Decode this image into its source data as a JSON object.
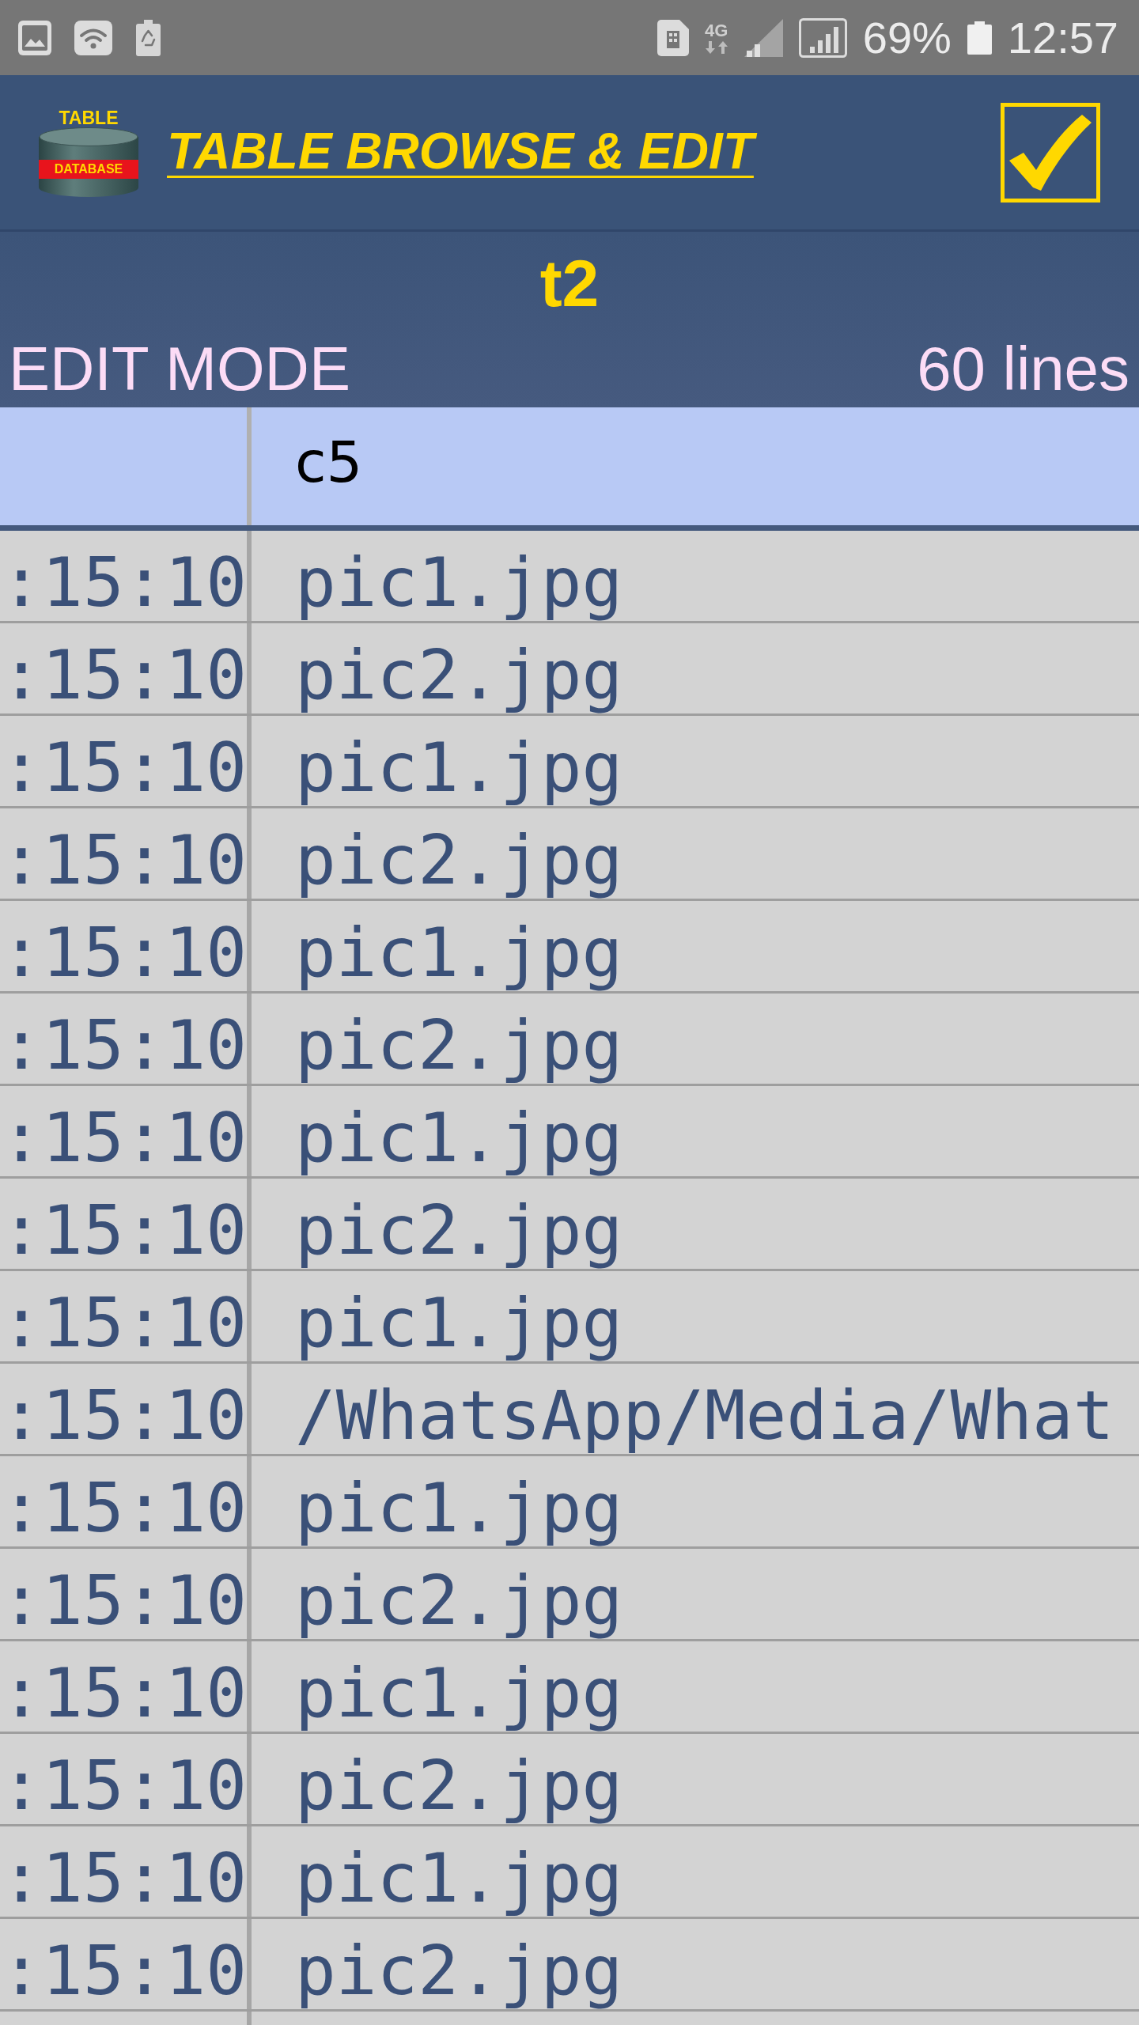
{
  "status_bar": {
    "network_type": "4G",
    "battery": "69%",
    "time": "12:57"
  },
  "app_bar": {
    "logo_top": "TABLE",
    "logo_band": "DATABASE",
    "title": "TABLE BROWSE & EDIT"
  },
  "table_info": {
    "name": "t2",
    "mode": "EDIT MODE",
    "line_count": "60 lines"
  },
  "table": {
    "column_2_heading": "c5",
    "rows": [
      {
        "column_1": ":15:10",
        "column_2": "pic1.jpg"
      },
      {
        "column_1": ":15:10",
        "column_2": "pic2.jpg"
      },
      {
        "column_1": ":15:10",
        "column_2": "pic1.jpg"
      },
      {
        "column_1": ":15:10",
        "column_2": "pic2.jpg"
      },
      {
        "column_1": ":15:10",
        "column_2": "pic1.jpg"
      },
      {
        "column_1": ":15:10",
        "column_2": "pic2.jpg"
      },
      {
        "column_1": ":15:10",
        "column_2": "pic1.jpg"
      },
      {
        "column_1": ":15:10",
        "column_2": "pic2.jpg"
      },
      {
        "column_1": ":15:10",
        "column_2": "pic1.jpg"
      },
      {
        "column_1": ":15:10",
        "column_2": "/WhatsApp/Media/What"
      },
      {
        "column_1": ":15:10",
        "column_2": "pic1.jpg"
      },
      {
        "column_1": ":15:10",
        "column_2": "pic2.jpg"
      },
      {
        "column_1": ":15:10",
        "column_2": "pic1.jpg"
      },
      {
        "column_1": ":15:10",
        "column_2": "pic2.jpg"
      },
      {
        "column_1": ":15:10",
        "column_2": "pic1.jpg"
      },
      {
        "column_1": ":15:10",
        "column_2": "pic2.jpg"
      }
    ]
  }
}
